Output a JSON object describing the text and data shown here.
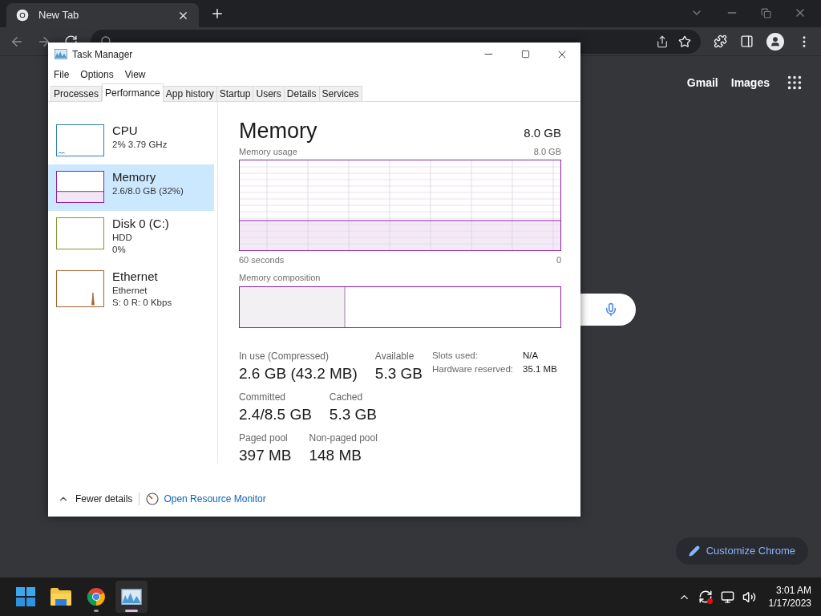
{
  "browser": {
    "tab": {
      "title": "New Tab"
    },
    "links": [
      "Gmail",
      "Images"
    ],
    "customize_button": "Customize Chrome"
  },
  "task_manager": {
    "title": "Task Manager",
    "menu": [
      "File",
      "Options",
      "View"
    ],
    "tabs": [
      {
        "label": "Processes",
        "selected": false
      },
      {
        "label": "Performance",
        "selected": true
      },
      {
        "label": "App history",
        "selected": false
      },
      {
        "label": "Startup",
        "selected": false
      },
      {
        "label": "Users",
        "selected": false
      },
      {
        "label": "Details",
        "selected": false
      },
      {
        "label": "Services",
        "selected": false
      }
    ],
    "sidebar": [
      {
        "kind": "cpu",
        "name": "CPU",
        "lines": [
          "2% 3.79 GHz"
        ],
        "color": "#2f7fb8",
        "selected": false
      },
      {
        "kind": "memory",
        "name": "Memory",
        "lines": [
          "2.6/8.0 GB (32%)"
        ],
        "color": "#8b1fae",
        "selected": true
      },
      {
        "kind": "disk",
        "name": "Disk 0 (C:)",
        "lines": [
          "HDD",
          "0%"
        ],
        "color": "#7a9a36",
        "selected": false
      },
      {
        "kind": "ethernet",
        "name": "Ethernet",
        "lines": [
          "Ethernet",
          "S: 0 R: 0 Kbps"
        ],
        "color": "#a6602a",
        "selected": false
      }
    ],
    "heading": "Memory",
    "total": "8.0 GB",
    "usage_graph": {
      "label": "Memory usage",
      "max": "8.0 GB",
      "x_start": "60 seconds",
      "x_end": "0"
    },
    "composition": {
      "label": "Memory composition",
      "level": 0.33
    },
    "stats": [
      [
        {
          "label": "In use (Compressed)",
          "value": "2.6 GB (43.2 MB)"
        },
        {
          "label": "Available",
          "value": "5.3 GB"
        }
      ],
      [
        {
          "label": "Committed",
          "value": "2.4/8.5 GB"
        },
        {
          "label": "Cached",
          "value": "5.3 GB"
        }
      ],
      [
        {
          "label": "Paged pool",
          "value": "397 MB"
        },
        {
          "label": "Non-paged pool",
          "value": "148 MB"
        }
      ]
    ],
    "details": [
      {
        "label": "Slots used:",
        "value": "N/A"
      },
      {
        "label": "Hardware reserved:",
        "value": "35.1 MB"
      }
    ],
    "footer": {
      "fewer": "Fewer details",
      "monitor": "Open Resource Monitor"
    }
  },
  "taskbar": {
    "apps": [
      {
        "kind": "start",
        "running": false,
        "selected": false
      },
      {
        "kind": "explorer",
        "running": false,
        "selected": false
      },
      {
        "kind": "chrome",
        "running": true,
        "selected": false
      },
      {
        "kind": "taskmgr",
        "running": true,
        "selected": true
      }
    ],
    "clock": {
      "time": "3:01 AM",
      "date": "1/17/2023"
    }
  }
}
